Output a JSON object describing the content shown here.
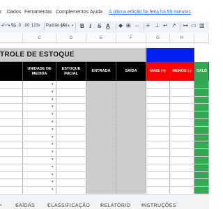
{
  "menu": {
    "items": [
      "r",
      "Dados",
      "Ferramentas",
      "Complementos",
      "Ajuda"
    ],
    "last_edit": "A última edição foi feita há 55 minutos"
  },
  "toolbar": {
    "format_number": "123",
    "font": "Padrão (Ari...",
    "font_size": "10",
    "bold": "B",
    "italic": "I",
    "strike": "S",
    "text_color": "A"
  },
  "sheet": {
    "columns": [
      "",
      "C",
      "D",
      "E",
      "F",
      "G",
      "H",
      ""
    ],
    "title": "TROLE DE ESTOQUE",
    "headers": [
      {
        "label": "",
        "style": "black"
      },
      {
        "label": "UNIDADE DE MEDIDA",
        "style": "black"
      },
      {
        "label": "ESTOQUE INICIAL",
        "style": "black"
      },
      {
        "label": "ENTRADA",
        "style": "black"
      },
      {
        "label": "SAÍDA",
        "style": "black"
      },
      {
        "label": "MAIS (+)",
        "style": "red"
      },
      {
        "label": "MENOS (-)",
        "style": "red"
      },
      {
        "label": "SALD",
        "style": "green"
      }
    ],
    "colors": {
      "title_bg": "#cccccc",
      "blue": "#0020f0",
      "red": "#ff0000",
      "green": "#34a853",
      "black": "#000000"
    }
  },
  "tabs": [
    {
      "label": "",
      "caret": "▾"
    },
    {
      "label": "SAÍDAS",
      "caret": "▾"
    },
    {
      "label": "CLASSIFICAÇÃO",
      "caret": "▾"
    },
    {
      "label": "RELATÓRIO",
      "caret": "▾"
    },
    {
      "label": "INSTRUÇÕES",
      "caret": "▾"
    }
  ]
}
